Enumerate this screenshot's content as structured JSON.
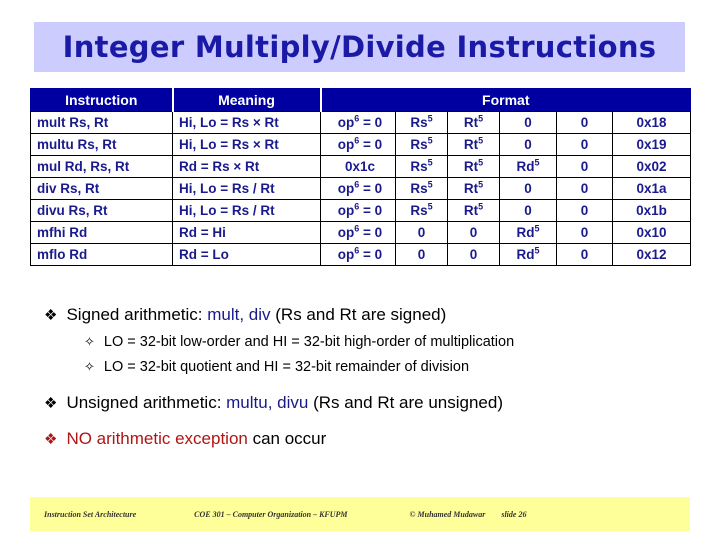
{
  "slide": {
    "title": "Integer Multiply/Divide Instructions",
    "title_bg": "#ccccff",
    "title_color": "#1a1aa6"
  },
  "table": {
    "header_bg": "#0000a0",
    "header_color": "#ffffff",
    "text_color": "#1a1a8c",
    "headers": {
      "instruction": "Instruction",
      "meaning": "Meaning",
      "format": "Format"
    },
    "rows": [
      {
        "instruction": "mult   Rs, Rt",
        "meaning": "Hi, Lo = Rs × Rt",
        "op": "op",
        "op_sup": "6",
        "op_rest": " = 0",
        "rs": "Rs",
        "rs_sup": "5",
        "rt": "Rt",
        "rt_sup": "5",
        "rd": "0",
        "rd_sup": "",
        "sh": "0",
        "func": "0x18"
      },
      {
        "instruction": "multu Rs, Rt",
        "meaning": "Hi, Lo = Rs × Rt",
        "op": "op",
        "op_sup": "6",
        "op_rest": " = 0",
        "rs": "Rs",
        "rs_sup": "5",
        "rt": "Rt",
        "rt_sup": "5",
        "rd": "0",
        "rd_sup": "",
        "sh": "0",
        "func": "0x19"
      },
      {
        "instruction": "mul    Rd, Rs, Rt",
        "meaning": "Rd = Rs × Rt",
        "op": "0x1c",
        "op_sup": "",
        "op_rest": "",
        "rs": "Rs",
        "rs_sup": "5",
        "rt": "Rt",
        "rt_sup": "5",
        "rd": "Rd",
        "rd_sup": "5",
        "sh": "0",
        "func": "0x02"
      },
      {
        "instruction": "div    Rs, Rt",
        "meaning": "Hi, Lo = Rs / Rt",
        "op": "op",
        "op_sup": "6",
        "op_rest": " = 0",
        "rs": "Rs",
        "rs_sup": "5",
        "rt": "Rt",
        "rt_sup": "5",
        "rd": "0",
        "rd_sup": "",
        "sh": "0",
        "func": "0x1a"
      },
      {
        "instruction": "divu   Rs, Rt",
        "meaning": "Hi, Lo = Rs / Rt",
        "op": "op",
        "op_sup": "6",
        "op_rest": " = 0",
        "rs": "Rs",
        "rs_sup": "5",
        "rt": "Rt",
        "rt_sup": "5",
        "rd": "0",
        "rd_sup": "",
        "sh": "0",
        "func": "0x1b"
      },
      {
        "instruction": "mfhi   Rd",
        "meaning": "Rd = Hi",
        "op": "op",
        "op_sup": "6",
        "op_rest": " = 0",
        "rs": "0",
        "rs_sup": "",
        "rt": "0",
        "rt_sup": "",
        "rd": "Rd",
        "rd_sup": "5",
        "sh": "0",
        "func": "0x10"
      },
      {
        "instruction": "mflo   Rd",
        "meaning": "Rd = Lo",
        "op": "op",
        "op_sup": "6",
        "op_rest": " = 0",
        "rs": "0",
        "rs_sup": "",
        "rt": "0",
        "rt_sup": "",
        "rd": "Rd",
        "rd_sup": "5",
        "sh": "0",
        "func": "0x12"
      }
    ]
  },
  "bullets": {
    "glyph_l1": "❖",
    "glyph_l2": "✧",
    "b1_pre": "Signed arithmetic: ",
    "b1_kw": "mult, div",
    "b1_post": " (Rs and Rt are signed)",
    "s1": "LO = 32-bit low-order and HI = 32-bit high-order of multiplication",
    "s2": "LO = 32-bit quotient and HI = 32-bit remainder of division",
    "b2_pre": "Unsigned arithmetic: ",
    "b2_kw": "multu, divu",
    "b2_post": " (Rs and Rt are unsigned)",
    "b3_red": "NO arithmetic exception",
    "b3_post": " can occur",
    "blue": "#1a1a8c",
    "red": "#b01414"
  },
  "footer": {
    "bg": "#ffff99",
    "left": "Instruction Set Architecture",
    "center": "COE 301 – Computer Organization – KFUPM",
    "right": "© Muhamed Mudawar",
    "slide": "slide 26"
  }
}
